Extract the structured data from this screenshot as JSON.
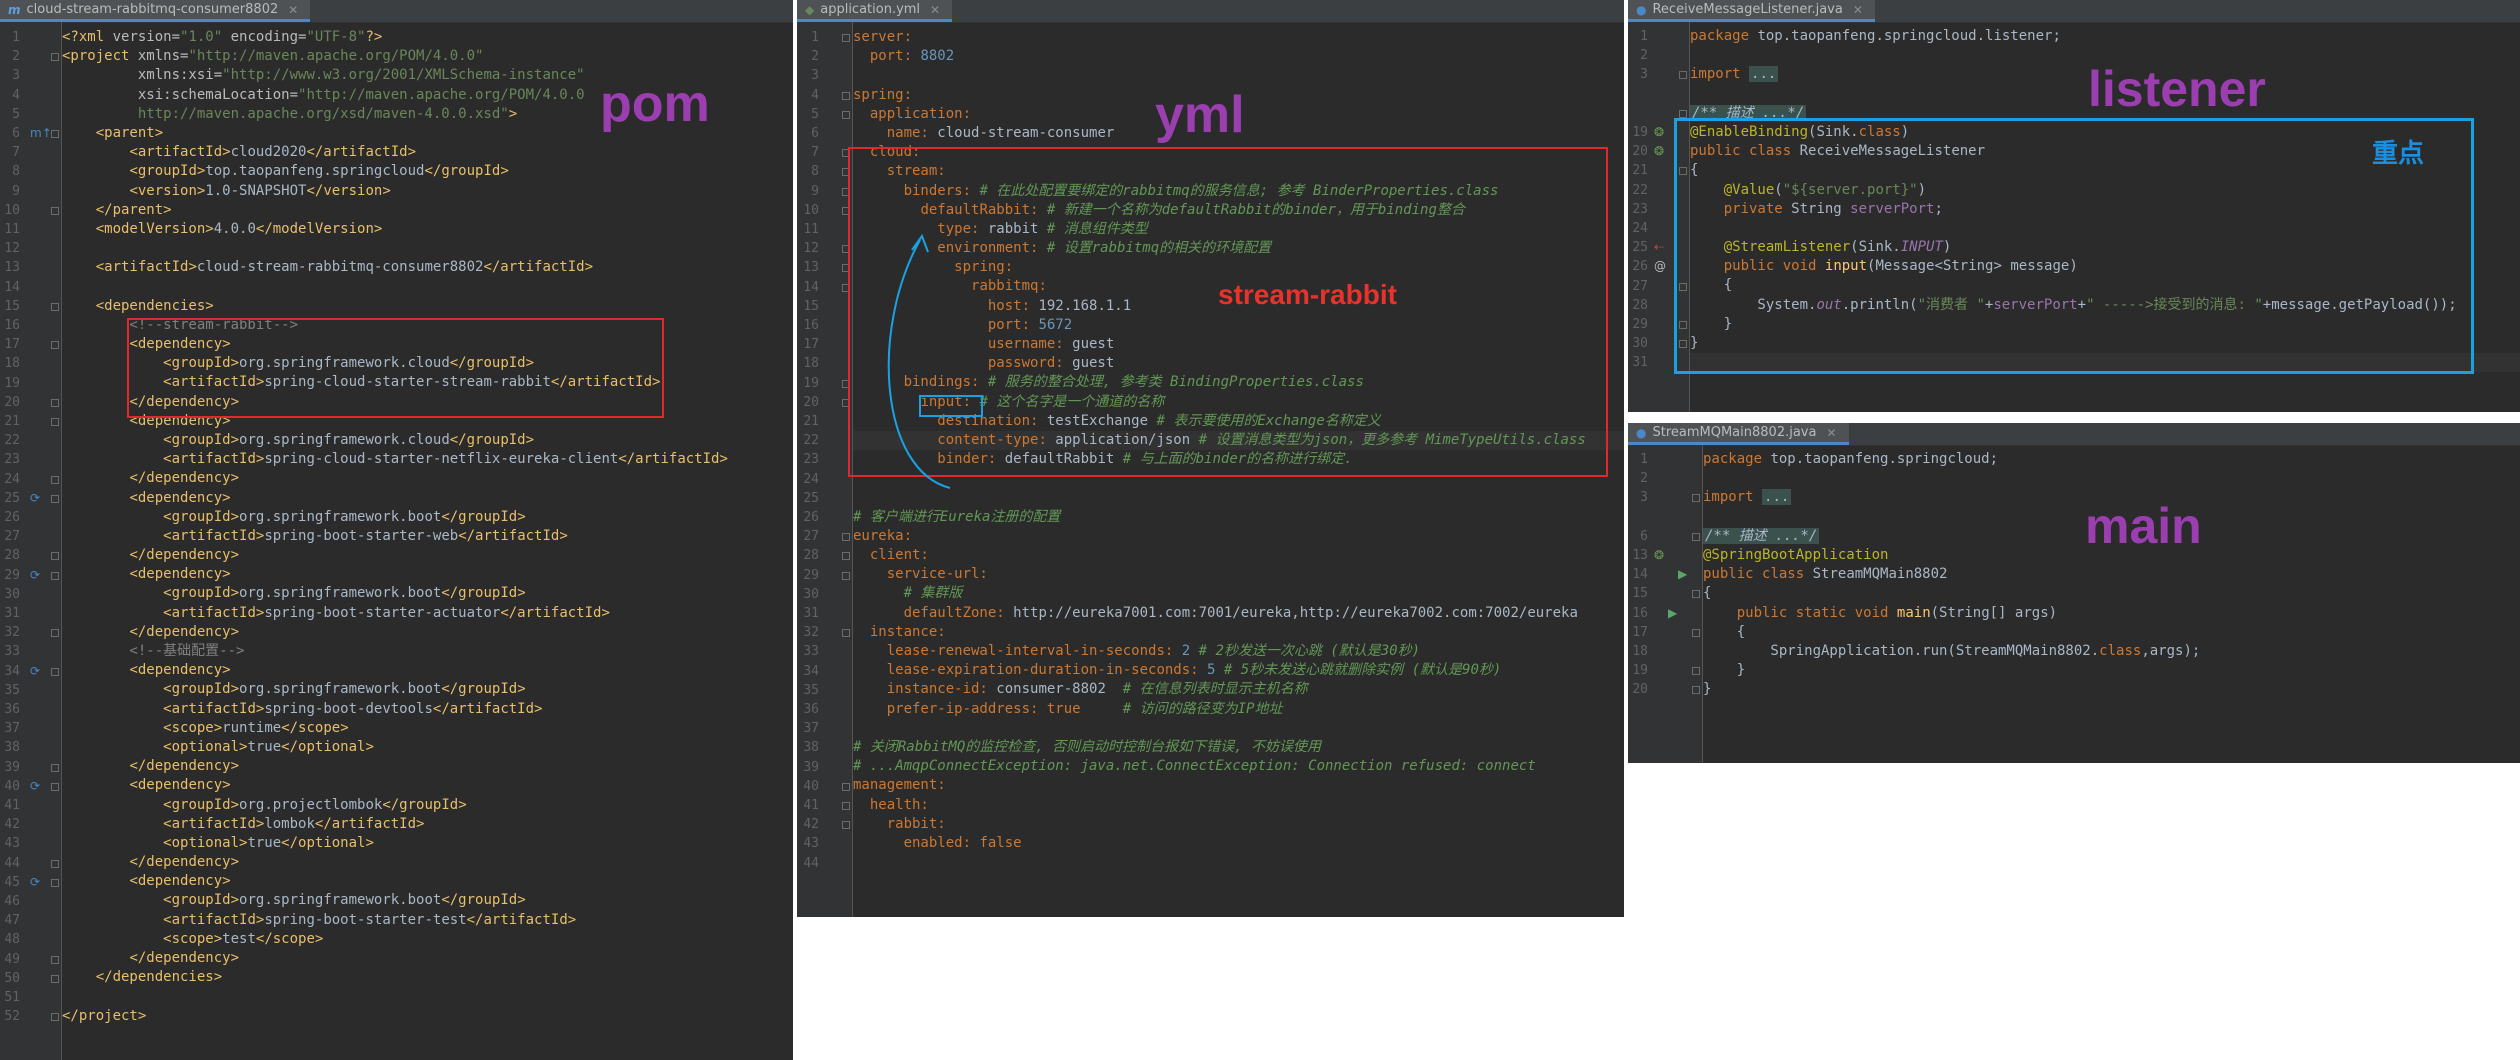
{
  "colors": {
    "purple_label": "#9b3fb0",
    "red_label": "#e8322c",
    "blue_label": "#1a8fe0",
    "red_box": "#e0292e",
    "blue_box": "#1ba1e2"
  },
  "labels": {
    "pom": "pom",
    "yml": "yml",
    "stream_rabbit": "stream-rabbit",
    "listener": "listener",
    "key_point": "重点",
    "main": "main"
  },
  "pom": {
    "tab_title": "cloud-stream-rabbitmq-consumer8802",
    "tab_icon": "m",
    "lines": [
      "<?xml version=\"1.0\" encoding=\"UTF-8\"?>",
      "<project xmlns=\"http://maven.apache.org/POM/4.0.0\"",
      "         xmlns:xsi=\"http://www.w3.org/2001/XMLSchema-instance\"",
      "         xsi:schemaLocation=\"http://maven.apache.org/POM/4.0.0",
      "         http://maven.apache.org/xsd/maven-4.0.0.xsd\">",
      "    <parent>",
      "        <artifactId>cloud2020</artifactId>",
      "        <groupId>top.taopanfeng.springcloud</groupId>",
      "        <version>1.0-SNAPSHOT</version>",
      "    </parent>",
      "    <modelVersion>4.0.0</modelVersion>",
      "",
      "    <artifactId>cloud-stream-rabbitmq-consumer8802</artifactId>",
      "",
      "    <dependencies>",
      "        <!--stream-rabbit-->",
      "        <dependency>",
      "            <groupId>org.springframework.cloud</groupId>",
      "            <artifactId>spring-cloud-starter-stream-rabbit</artifactId>",
      "        </dependency>",
      "        <dependency>",
      "            <groupId>org.springframework.cloud</groupId>",
      "            <artifactId>spring-cloud-starter-netflix-eureka-client</artifactId>",
      "        </dependency>",
      "        <dependency>",
      "            <groupId>org.springframework.boot</groupId>",
      "            <artifactId>spring-boot-starter-web</artifactId>",
      "        </dependency>",
      "        <dependency>",
      "            <groupId>org.springframework.boot</groupId>",
      "            <artifactId>spring-boot-starter-actuator</artifactId>",
      "        </dependency>",
      "        <!--基础配置-->",
      "        <dependency>",
      "            <groupId>org.springframework.boot</groupId>",
      "            <artifactId>spring-boot-devtools</artifactId>",
      "            <scope>runtime</scope>",
      "            <optional>true</optional>",
      "        </dependency>",
      "        <dependency>",
      "            <groupId>org.projectlombok</groupId>",
      "            <artifactId>lombok</artifactId>",
      "            <optional>true</optional>",
      "        </dependency>",
      "        <dependency>",
      "            <groupId>org.springframework.boot</groupId>",
      "            <artifactId>spring-boot-starter-test</artifactId>",
      "            <scope>test</scope>",
      "        </dependency>",
      "    </dependencies>",
      "",
      "</project>"
    ]
  },
  "yml": {
    "tab_title": "application.yml",
    "lines": [
      "server:",
      "  port: 8802",
      "",
      "spring:",
      "  application:",
      "    name: cloud-stream-consumer",
      "  cloud:",
      "    stream:",
      "      binders: # 在此处配置要绑定的rabbitmq的服务信息; 参考 BinderProperties.class",
      "        defaultRabbit: # 新建一个名称为defaultRabbit的binder，用于binding整合",
      "          type: rabbit # 消息组件类型",
      "          environment: # 设置rabbitmq的相关的环境配置",
      "            spring:",
      "              rabbitmq:",
      "                host: 192.168.1.1",
      "                port: 5672",
      "                username: guest",
      "                password: guest",
      "      bindings: # 服务的整合处理, 参考类 BindingProperties.class",
      "        input: # 这个名字是一个通道的名称",
      "          destination: testExchange # 表示要使用的Exchange名称定义",
      "          content-type: application/json # 设置消息类型为json，更多参考 MimeTypeUtils.class",
      "          binder: defaultRabbit # 与上面的binder的名称进行绑定.",
      "",
      "",
      "# 客户端进行Eureka注册的配置",
      "eureka:",
      "  client:",
      "    service-url:",
      "      # 集群版",
      "      defaultZone: http://eureka7001.com:7001/eureka,http://eureka7002.com:7002/eureka",
      "  instance:",
      "    lease-renewal-interval-in-seconds: 2 # 2秒发送一次心跳 (默认是30秒)",
      "    lease-expiration-duration-in-seconds: 5 # 5秒未发送心跳就删除实例 (默认是90秒)",
      "    instance-id: consumer-8802  # 在信息列表时显示主机名称",
      "    prefer-ip-address: true     # 访问的路径变为IP地址",
      "",
      "# 关闭RabbitMQ的监控检查, 否则启动时控制台报如下错误, 不妨误使用",
      "# ...AmqpConnectException: java.net.ConnectException: Connection refused: connect",
      "management:",
      "  health:",
      "    rabbit:",
      "      enabled: false",
      ""
    ]
  },
  "listener": {
    "tab_title": "ReceiveMessageListener.java",
    "line_numbers": [
      "1",
      "2",
      "3",
      "",
      "",
      "",
      "",
      "",
      "",
      "",
      "",
      "",
      "",
      "",
      "",
      "",
      "",
      ""
    ],
    "lines": [
      "package top.taopanfeng.springcloud.listener;",
      "",
      "import ...",
      "",
      "/** 描述 ...*/",
      "@EnableBinding(Sink.class)",
      "public class ReceiveMessageListener",
      "{",
      "    @Value(\"${server.port}\")",
      "    private String serverPort;",
      "",
      "    @StreamListener(Sink.INPUT)",
      "    public void input(Message<String> message)",
      "    {",
      "        System.out.println(\"消费者 \"+serverPort+\" ----->接受到的消息: \"+message.getPayload());",
      "    }",
      "}",
      ""
    ],
    "numbers": [
      "1",
      "2",
      "3",
      "",
      "",
      "",
      "",
      "",
      "",
      "",
      "",
      "",
      "",
      "",
      "",
      "",
      "",
      ""
    ]
  },
  "main": {
    "tab_title": "StreamMQMain8802.java",
    "lines": [
      "package top.taopanfeng.springcloud;",
      "",
      "import ...",
      "",
      "/** 描述 ...*/",
      "@SpringBootApplication",
      "public class StreamMQMain8802",
      "{",
      "    public static void main(String[] args)",
      "    {",
      "        SpringApplication.run(StreamMQMain8802.class,args);",
      "    }",
      "}"
    ]
  }
}
